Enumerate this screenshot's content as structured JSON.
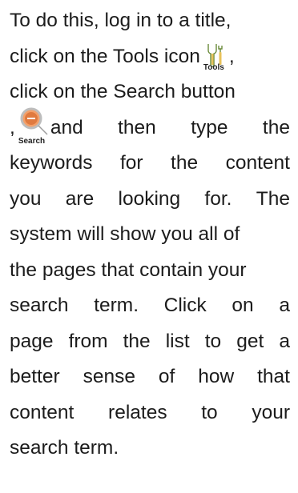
{
  "lines": [
    [
      "To do this, log in to a title,"
    ],
    [
      "click on the Tools icon",
      ","
    ],
    [
      "click on the Search button"
    ],
    [
      ",",
      "and",
      "then",
      "type",
      "the"
    ],
    [
      "keywords",
      "for",
      "the",
      "content"
    ],
    [
      "you",
      "are",
      "looking",
      "for.",
      "The"
    ],
    [
      "system will show you all of"
    ],
    [
      "the pages that contain your"
    ],
    [
      "search",
      "term.",
      "Click",
      "on",
      "a"
    ],
    [
      "page",
      "from",
      "the",
      "list",
      "to",
      "get",
      "a"
    ],
    [
      "better",
      "sense",
      "of",
      "how",
      "that"
    ],
    [
      "content",
      "relates",
      "to",
      "your"
    ],
    [
      "search term."
    ]
  ],
  "icons": {
    "tools": {
      "name": "tools-icon",
      "caption": "Tools",
      "colors": [
        "#e8c25a",
        "#6a8a3a"
      ]
    },
    "search": {
      "name": "search-icon",
      "caption": "Search",
      "colors": [
        "#e07a3f",
        "#bdbdbd"
      ]
    }
  }
}
